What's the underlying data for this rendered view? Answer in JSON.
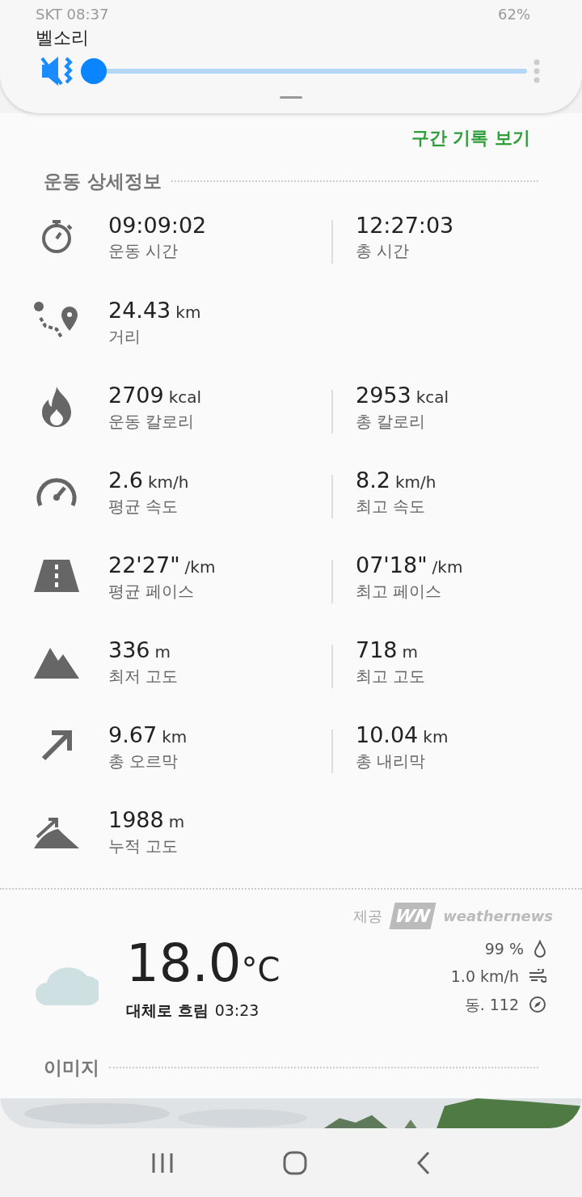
{
  "status_bar": {
    "carrier_time": "SKT 08:37",
    "battery": "62%"
  },
  "volume_panel": {
    "label": "벨소리",
    "muted": true,
    "level": 0.0
  },
  "section_link": "구간 기록 보기",
  "details": {
    "title": "운동 상세정보",
    "rows": [
      {
        "left": {
          "value": "09:09:02",
          "label": "운동 시간"
        },
        "right": {
          "value": "12:27:03",
          "label": "총 시간"
        }
      },
      {
        "left": {
          "value": "24.43",
          "unit": "km",
          "label": "거리"
        }
      },
      {
        "left": {
          "value": "2709",
          "unit": "kcal",
          "label": "운동 칼로리"
        },
        "right": {
          "value": "2953",
          "unit": "kcal",
          "label": "총 칼로리"
        }
      },
      {
        "left": {
          "value": "2.6",
          "unit": "km/h",
          "label": "평균 속도"
        },
        "right": {
          "value": "8.2",
          "unit": "km/h",
          "label": "최고 속도"
        }
      },
      {
        "left": {
          "value": "22'27\"",
          "unit": "/km",
          "label": "평균 페이스"
        },
        "right": {
          "value": "07'18\"",
          "unit": "/km",
          "label": "최고 페이스"
        }
      },
      {
        "left": {
          "value": "336",
          "unit": "m",
          "label": "최저 고도"
        },
        "right": {
          "value": "718",
          "unit": "m",
          "label": "최고 고도"
        }
      },
      {
        "left": {
          "value": "9.67",
          "unit": "km",
          "label": "총 오르막"
        },
        "right": {
          "value": "10.04",
          "unit": "km",
          "label": "총 내리막"
        }
      },
      {
        "left": {
          "value": "1988",
          "unit": "m",
          "label": "누적 고도"
        }
      }
    ]
  },
  "weather": {
    "provider_label": "제공",
    "provider_logo": "WN",
    "provider_name": "weathernews",
    "temperature": "18.0",
    "unit": "°C",
    "condition": "대체로 흐림",
    "time": "03:23",
    "humidity": "99 %",
    "wind_speed": "1.0 km/h",
    "wind_direction": "동. 112"
  },
  "images_title": "이미지"
}
